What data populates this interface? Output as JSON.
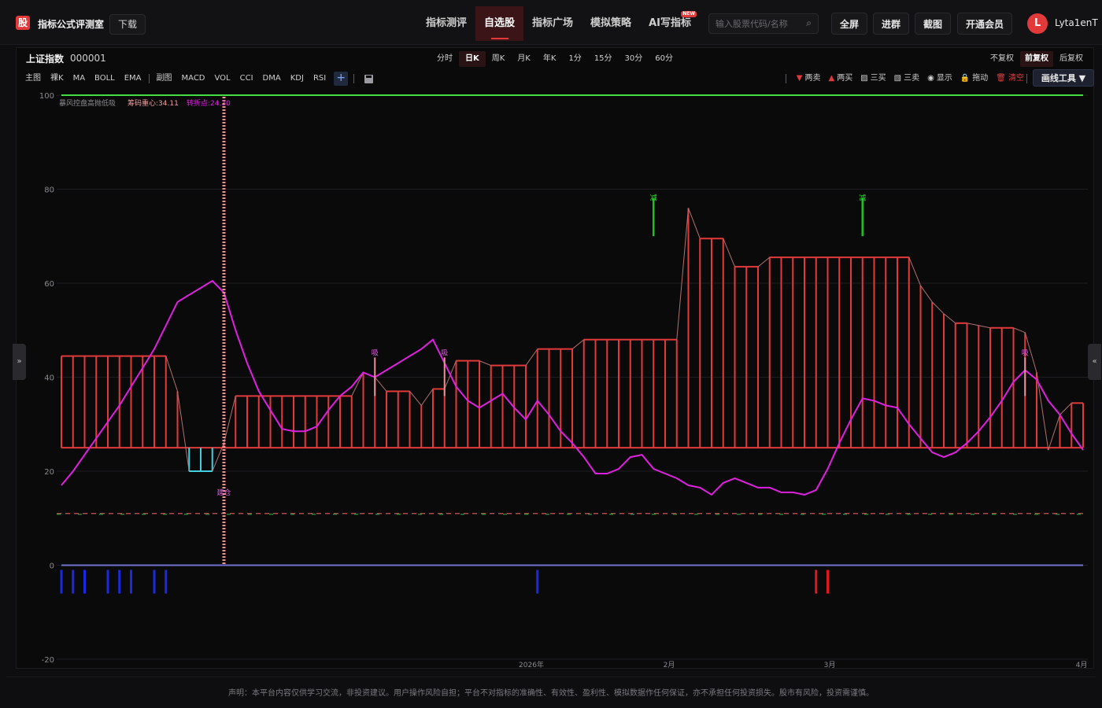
{
  "topbar": {
    "logo_glyph": "股",
    "app_title": "指标公式评测室",
    "download_label": "下载",
    "nav": [
      {
        "label": "指标测评",
        "active": false,
        "badge": ""
      },
      {
        "label": "自选股",
        "active": true,
        "badge": ""
      },
      {
        "label": "指标广场",
        "active": false,
        "badge": ""
      },
      {
        "label": "模拟策略",
        "active": false,
        "badge": ""
      },
      {
        "label": "AI写指标",
        "active": false,
        "badge": "NEW"
      }
    ],
    "search_placeholder": "输入股票代码/名称",
    "buttons": [
      "全屏",
      "进群",
      "截图",
      "开通会员"
    ],
    "avatar_letter": "L",
    "username": "Lyta1enT"
  },
  "stock": {
    "name": "上证指数",
    "code": "000001"
  },
  "period_tabs": [
    {
      "label": "分时",
      "active": false
    },
    {
      "label": "日K",
      "active": true
    },
    {
      "label": "周K",
      "active": false
    },
    {
      "label": "月K",
      "active": false
    },
    {
      "label": "年K",
      "active": false
    },
    {
      "label": "1分",
      "active": false
    },
    {
      "label": "15分",
      "active": false
    },
    {
      "label": "30分",
      "active": false
    },
    {
      "label": "60分",
      "active": false
    }
  ],
  "adjust_tabs": [
    {
      "label": "不复权",
      "active": false
    },
    {
      "label": "前复权",
      "active": true
    },
    {
      "label": "后复权",
      "active": false
    }
  ],
  "indicators_main": [
    "主图",
    "裸K",
    "MA",
    "BOLL",
    "EMA"
  ],
  "indicators_sub": [
    "副图",
    "MACD",
    "VOL",
    "CCI",
    "DMA",
    "KDJ",
    "RSI"
  ],
  "draw_tools": [
    {
      "label": "两卖",
      "icon": "triangle-down-icon",
      "color": "#e23a3a",
      "glyph": "▼"
    },
    {
      "label": "两买",
      "icon": "triangle-up-icon",
      "color": "#e23a3a",
      "glyph": "▲"
    },
    {
      "label": "三买",
      "icon": "line-chart-icon",
      "color": "#cfcfcf",
      "glyph": "▨"
    },
    {
      "label": "三卖",
      "icon": "line-chart-icon",
      "color": "#cfcfcf",
      "glyph": "▧"
    },
    {
      "label": "显示",
      "icon": "eye-icon",
      "color": "#cfcfcf",
      "glyph": "◉"
    },
    {
      "label": "拖动",
      "icon": "lock-icon",
      "color": "#f0c040",
      "glyph": "🔒"
    },
    {
      "label": "清空",
      "icon": "trash-icon",
      "color": "#e23a3a",
      "glyph": "🗑"
    }
  ],
  "draw_button_label": "画线工具 ▼",
  "disclaimer": "声明：本平台内容仅供学习交流，非投资建议。用户操作风险自担；平台不对指标的准确性、有效性、盈利性、模拟数据作任何保证，亦不承担任何投资损失。股市有风险，投资需谨慎。",
  "chart_data": {
    "type": "line",
    "legend": [
      {
        "text": "暴风控盘高抛低吸",
        "color": "#8a8a90"
      },
      {
        "text": "筹码重心:34.11",
        "color": "#f0a0a0"
      },
      {
        "text": "转折点:24.30",
        "color": "#e020e0"
      }
    ],
    "y_ticks": [
      100,
      80,
      60,
      40,
      20,
      0,
      -20
    ],
    "ylim": [
      -20,
      100
    ],
    "x_labels": [
      "2026年",
      "2月",
      "3月",
      "4月"
    ],
    "n_bars": 89,
    "reference_line": {
      "value": 100,
      "color": "#44dd44"
    },
    "zero_line": {
      "value": 0,
      "color": "#7070d0"
    },
    "band_base": 25,
    "band_top": [
      44.5,
      44.5,
      44.5,
      44.5,
      44.5,
      44.5,
      44.5,
      44.5,
      44.5,
      44.5,
      37,
      20,
      20,
      20,
      26,
      36,
      36,
      36,
      36,
      36,
      36,
      36,
      36,
      36,
      36,
      36,
      41,
      40,
      37,
      37,
      37,
      34,
      37.5,
      37.5,
      43.5,
      43.5,
      43.5,
      42.5,
      42.5,
      42.5,
      42.5,
      46,
      46,
      46,
      46,
      48,
      48,
      48,
      48,
      48,
      48,
      48,
      48,
      48,
      76,
      69.5,
      69.5,
      69.5,
      63.5,
      63.5,
      63.5,
      65.5,
      65.5,
      65.5,
      65.5,
      65.5,
      65.5,
      65.5,
      65.5,
      65.5,
      65.5,
      65.5,
      65.5,
      65.5,
      59.5,
      56,
      53.5,
      51.5,
      51.5,
      51,
      50.5,
      50.5,
      50.5,
      49.5,
      41,
      24.5,
      32,
      34.5,
      34.5
    ],
    "band_colors_below": [
      11,
      12,
      13
    ],
    "magenta_line": [
      17,
      20,
      23.5,
      27,
      30.5,
      34,
      38,
      42,
      46,
      51,
      56,
      57.5,
      59,
      60.5,
      58,
      50,
      43,
      37,
      33,
      29,
      28.5,
      28.5,
      29.5,
      33,
      36,
      38,
      41,
      40,
      41.5,
      43,
      44.5,
      46,
      48,
      43,
      38,
      35,
      33.5,
      35,
      36.5,
      33.5,
      31,
      35,
      32,
      28.5,
      26,
      23,
      19.5,
      19.5,
      20.5,
      23,
      23.5,
      20.5,
      19.5,
      18.5,
      17,
      16.5,
      15,
      17.5,
      18.5,
      17.5,
      16.5,
      16.5,
      15.5,
      15.5,
      15,
      16,
      20.5,
      26,
      31,
      35.5,
      35,
      34,
      33.5,
      30,
      27,
      24,
      23,
      24,
      26,
      28.5,
      31.5,
      35,
      39,
      41.5,
      39.5,
      35,
      32,
      28,
      24.5
    ],
    "dashed_line_value": 11,
    "buy_signals": [
      {
        "bar": 27,
        "label": "吸",
        "value": 35
      },
      {
        "bar": 33,
        "label": "吸",
        "value": 35
      },
      {
        "bar": 83,
        "label": "吸",
        "value": 35
      }
    ],
    "sell_signals": [
      {
        "bar": 51,
        "label": "减",
        "value": 70
      },
      {
        "bar": 69,
        "label": "减",
        "value": 70
      }
    ],
    "vertical_marker": {
      "bar": 14,
      "label": "建仓",
      "value": 15
    },
    "bottom_blue_bars": [
      0,
      1,
      2,
      4,
      5,
      6,
      8,
      9,
      41
    ],
    "bottom_red_bars": [
      65,
      66
    ]
  }
}
